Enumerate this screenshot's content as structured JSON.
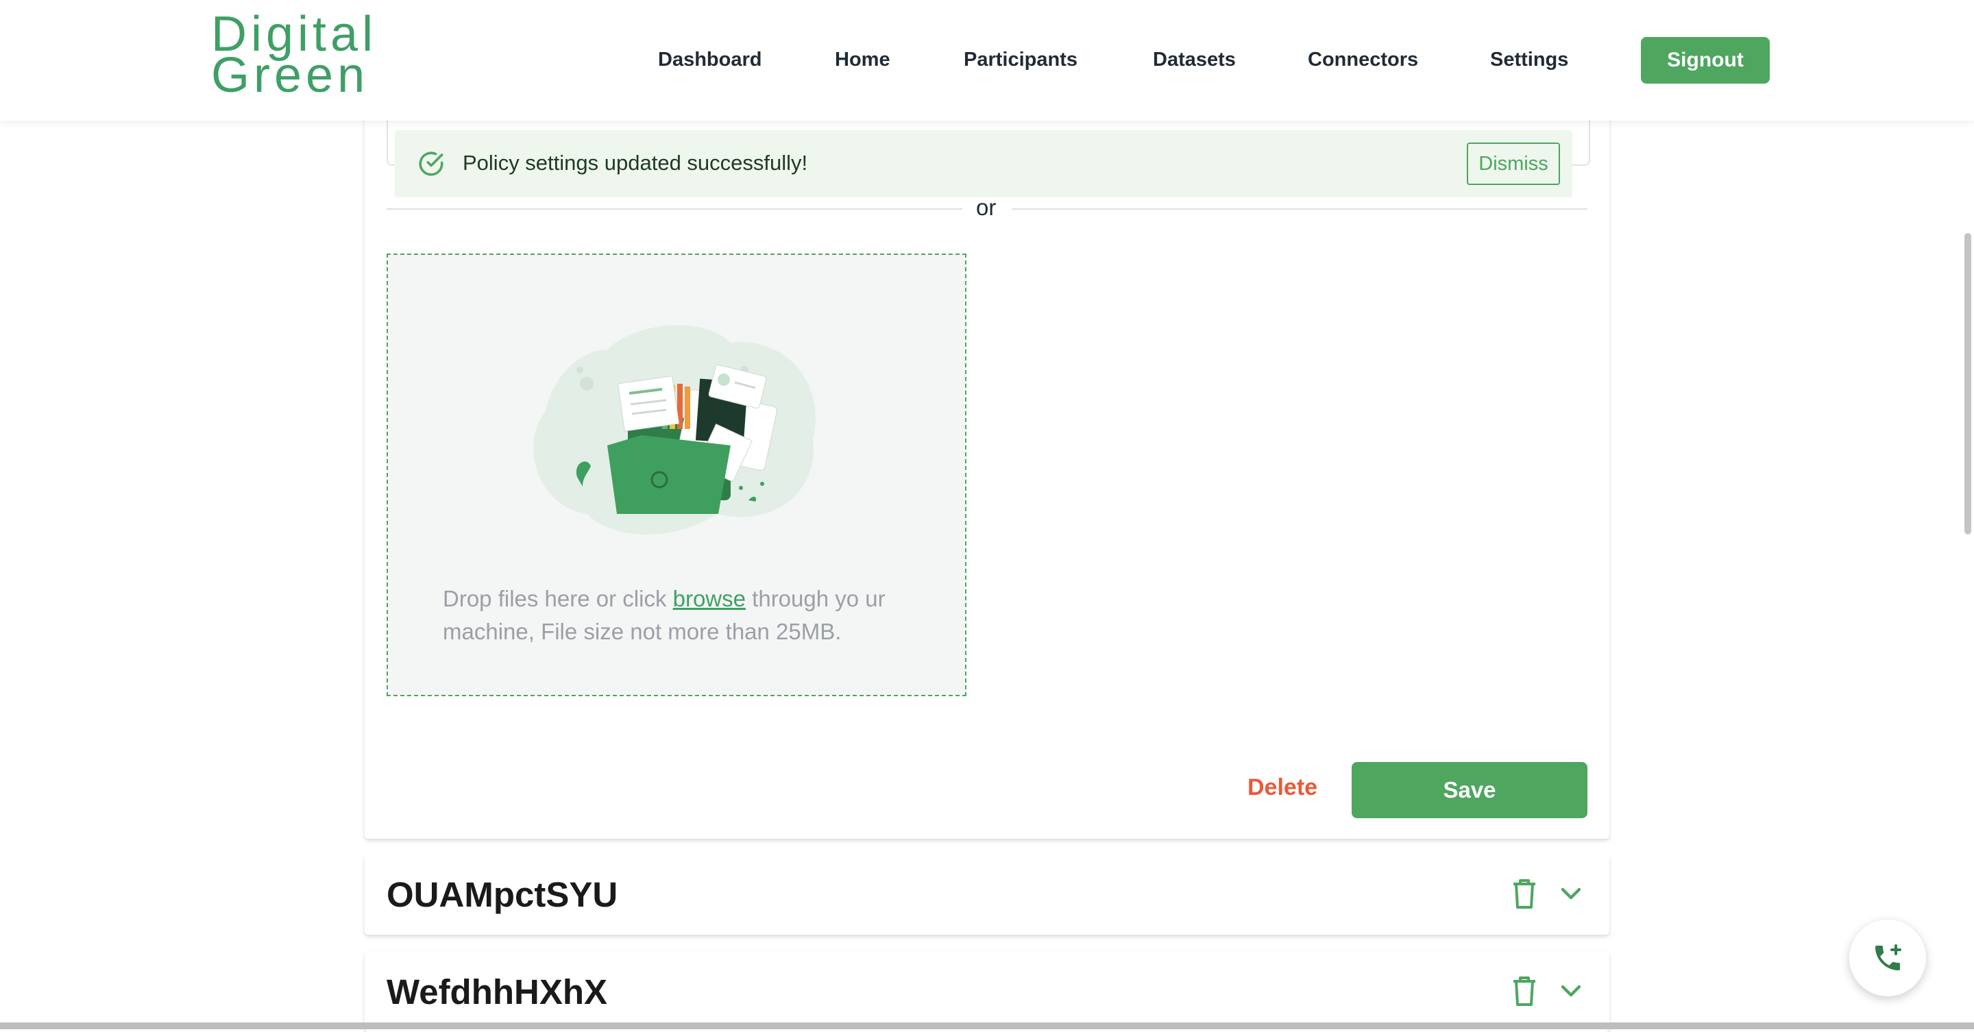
{
  "header": {
    "logo_line1": "Digital",
    "logo_line2": "Green",
    "nav": [
      "Dashboard",
      "Home",
      "Participants",
      "Datasets",
      "Connectors",
      "Settings"
    ],
    "signout_label": "Signout"
  },
  "alert": {
    "message": "Policy settings updated successfully!",
    "dismiss_label": "Dismiss"
  },
  "divider_text": "or",
  "upload": {
    "text_before": "Drop files here or click ",
    "link": "browse",
    "text_after": " through yo ur machine, File size not more than 25MB."
  },
  "actions": {
    "delete_label": "Delete",
    "save_label": "Save"
  },
  "rows": [
    {
      "title": "OUAMpctSYU"
    },
    {
      "title": "WefdhhHXhX"
    }
  ],
  "colors": {
    "brand": "#4ea65f",
    "danger": "#e95b38",
    "alert_bg": "#eef6ee"
  }
}
